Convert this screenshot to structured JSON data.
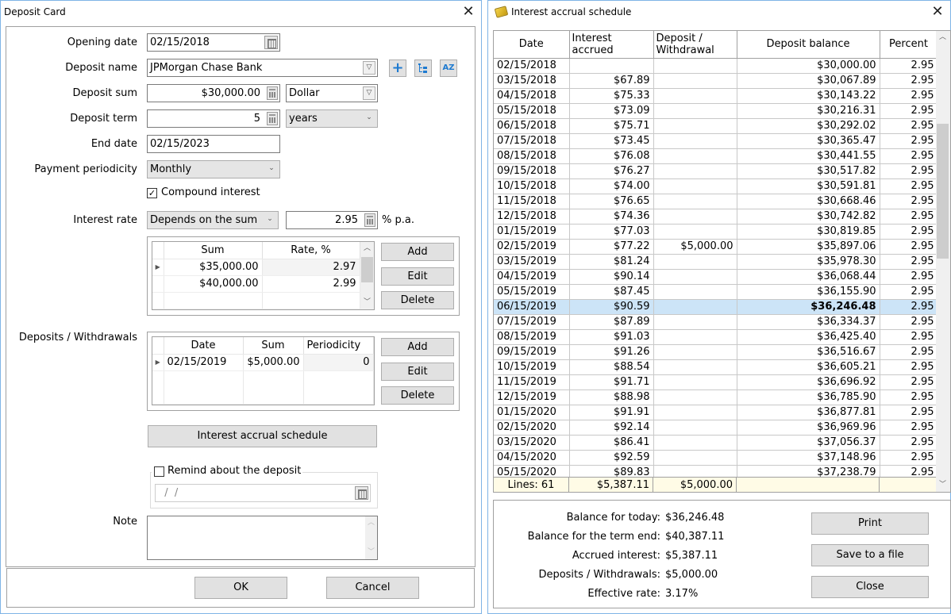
{
  "deposit_card": {
    "title": "Deposit Card",
    "fields": {
      "opening_date": {
        "label": "Opening date",
        "value": "02/15/2018"
      },
      "deposit_name": {
        "label": "Deposit name",
        "value": "JPMorgan Chase Bank"
      },
      "deposit_sum": {
        "label": "Deposit sum",
        "value": "$30,000.00",
        "currency": "Dollar"
      },
      "deposit_term": {
        "label": "Deposit term",
        "value": "5",
        "unit": "years"
      },
      "end_date": {
        "label": "End date",
        "value": "02/15/2023"
      },
      "payment_periodicity": {
        "label": "Payment periodicity",
        "value": "Monthly"
      },
      "compound_interest": {
        "label": "Compound interest",
        "checked": true,
        "mark": "✓"
      },
      "interest_rate": {
        "label": "Interest rate",
        "mode": "Depends on the sum",
        "value": "2.95",
        "suffix": "% p.a."
      }
    },
    "rate_table": {
      "columns": [
        "Sum",
        "Rate, %"
      ],
      "rows": [
        {
          "sum": "$35,000.00",
          "rate": "2.97"
        },
        {
          "sum": "$40,000.00",
          "rate": "2.99"
        }
      ],
      "buttons": {
        "add": "Add",
        "edit": "Edit",
        "delete": "Delete"
      }
    },
    "deposits_withdrawals": {
      "label": "Deposits / Withdrawals",
      "columns": [
        "Date",
        "Sum",
        "Periodicity"
      ],
      "rows": [
        {
          "date": "02/15/2019",
          "sum": "$5,000.00",
          "periodicity": "0"
        }
      ],
      "buttons": {
        "add": "Add",
        "edit": "Edit",
        "delete": "Delete"
      }
    },
    "schedule_button": "Interest accrual schedule",
    "reminder": {
      "label": "Remind about the deposit",
      "checked": false,
      "date_value": "  /  /"
    },
    "note": {
      "label": "Note",
      "value": ""
    },
    "ok_label": "OK",
    "cancel_label": "Cancel",
    "icons": {
      "add": "+",
      "tree": "⋮=",
      "sort": "AZ"
    }
  },
  "schedule": {
    "title": "Interest accrual schedule",
    "columns": [
      "Date",
      "Interest accrued",
      "Deposit / Withdrawal",
      "Deposit balance",
      "Percent"
    ],
    "selected_index": 16,
    "rows": [
      [
        "02/15/2018",
        "",
        "",
        "$30,000.00",
        "2.95"
      ],
      [
        "03/15/2018",
        "$67.89",
        "",
        "$30,067.89",
        "2.95"
      ],
      [
        "04/15/2018",
        "$75.33",
        "",
        "$30,143.22",
        "2.95"
      ],
      [
        "05/15/2018",
        "$73.09",
        "",
        "$30,216.31",
        "2.95"
      ],
      [
        "06/15/2018",
        "$75.71",
        "",
        "$30,292.02",
        "2.95"
      ],
      [
        "07/15/2018",
        "$73.45",
        "",
        "$30,365.47",
        "2.95"
      ],
      [
        "08/15/2018",
        "$76.08",
        "",
        "$30,441.55",
        "2.95"
      ],
      [
        "09/15/2018",
        "$76.27",
        "",
        "$30,517.82",
        "2.95"
      ],
      [
        "10/15/2018",
        "$74.00",
        "",
        "$30,591.81",
        "2.95"
      ],
      [
        "11/15/2018",
        "$76.65",
        "",
        "$30,668.46",
        "2.95"
      ],
      [
        "12/15/2018",
        "$74.36",
        "",
        "$30,742.82",
        "2.95"
      ],
      [
        "01/15/2019",
        "$77.03",
        "",
        "$30,819.85",
        "2.95"
      ],
      [
        "02/15/2019",
        "$77.22",
        "$5,000.00",
        "$35,897.06",
        "2.95"
      ],
      [
        "03/15/2019",
        "$81.24",
        "",
        "$35,978.30",
        "2.95"
      ],
      [
        "04/15/2019",
        "$90.14",
        "",
        "$36,068.44",
        "2.95"
      ],
      [
        "05/15/2019",
        "$87.45",
        "",
        "$36,155.90",
        "2.95"
      ],
      [
        "06/15/2019",
        "$90.59",
        "",
        "$36,246.48",
        "2.95"
      ],
      [
        "07/15/2019",
        "$87.89",
        "",
        "$36,334.37",
        "2.95"
      ],
      [
        "08/15/2019",
        "$91.03",
        "",
        "$36,425.40",
        "2.95"
      ],
      [
        "09/15/2019",
        "$91.26",
        "",
        "$36,516.67",
        "2.95"
      ],
      [
        "10/15/2019",
        "$88.54",
        "",
        "$36,605.21",
        "2.95"
      ],
      [
        "11/15/2019",
        "$91.71",
        "",
        "$36,696.92",
        "2.95"
      ],
      [
        "12/15/2019",
        "$88.98",
        "",
        "$36,785.90",
        "2.95"
      ],
      [
        "01/15/2020",
        "$91.91",
        "",
        "$36,877.81",
        "2.95"
      ],
      [
        "02/15/2020",
        "$92.14",
        "",
        "$36,969.96",
        "2.95"
      ],
      [
        "03/15/2020",
        "$86.41",
        "",
        "$37,056.37",
        "2.95"
      ],
      [
        "04/15/2020",
        "$92.59",
        "",
        "$37,148.96",
        "2.95"
      ],
      [
        "05/15/2020",
        "$89.83",
        "",
        "$37,238.79",
        "2.95"
      ]
    ],
    "footer": {
      "lines": "Lines: 61",
      "interest_total": "$5,387.11",
      "deposit_total": "$5,000.00"
    },
    "summary": [
      {
        "label": "Balance for today:",
        "value": "$36,246.48"
      },
      {
        "label": "Balance for the term end:",
        "value": "$40,387.11"
      },
      {
        "label": "Accrued interest:",
        "value": "$5,387.11"
      },
      {
        "label": "Deposits / Withdrawals:",
        "value": "$5,000.00"
      },
      {
        "label": "Effective rate:",
        "value": "3.17%"
      }
    ],
    "buttons": {
      "print": "Print",
      "save": "Save to a file",
      "close": "Close"
    }
  },
  "colors": {
    "selection": "#cce4f7",
    "footer_bg": "#fffbe6",
    "accent_icon": "#1e7ad0",
    "window_border": "#7fb4e6"
  }
}
